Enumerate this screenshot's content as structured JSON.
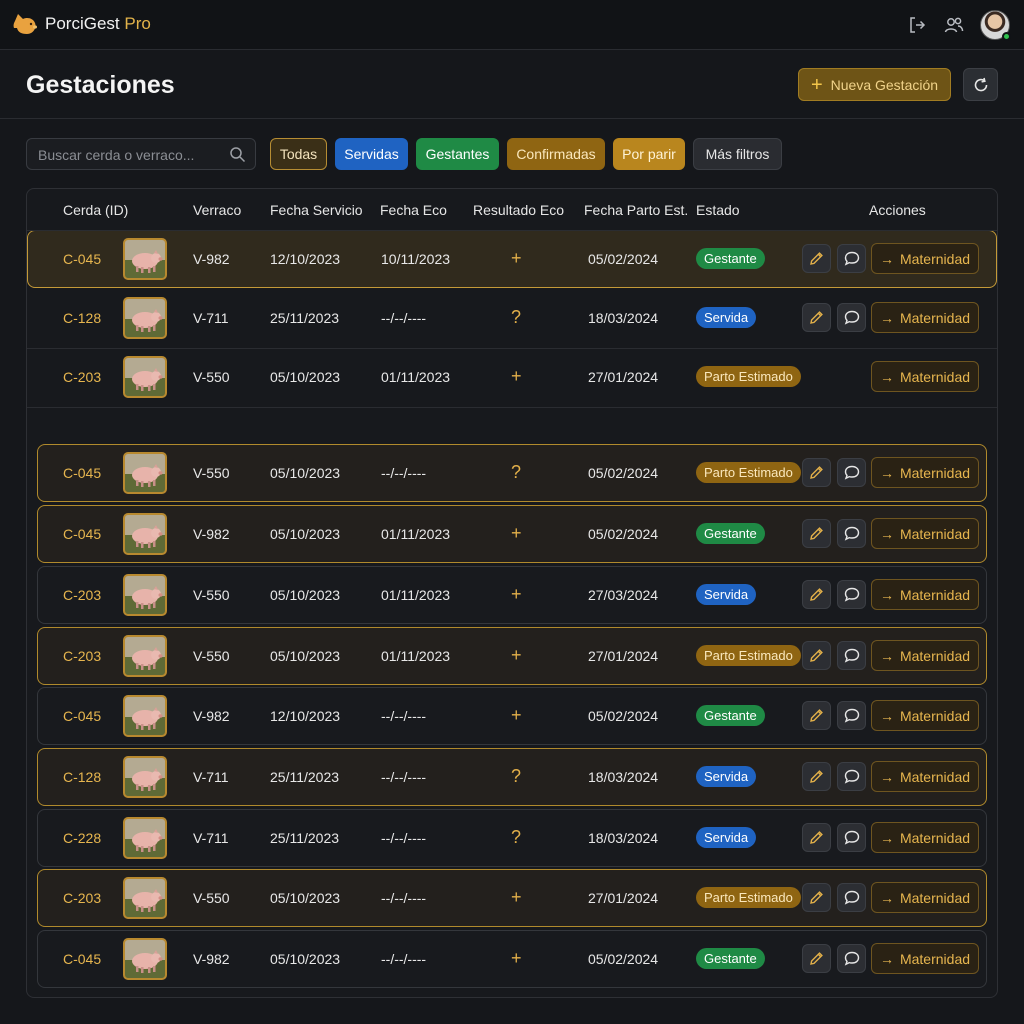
{
  "app": {
    "brand": "PorciGest",
    "brand_suffix": "Pro"
  },
  "header": {
    "title": "Gestaciones",
    "new_label": "Nueva Gestación"
  },
  "search": {
    "placeholder": "Buscar cerda o verraco..."
  },
  "filters": [
    {
      "label": "Todas",
      "active": true
    },
    {
      "label": "Servidas"
    },
    {
      "label": "Gestantes"
    },
    {
      "label": "Confirmadas"
    },
    {
      "label": "Por parir"
    },
    {
      "label": "Más filtros"
    }
  ],
  "columns": {
    "cerda": "Cerda (ID)",
    "verraco": "Verraco",
    "fecha_servicio": "Fecha Servicio",
    "fecha_eco": "Fecha Eco",
    "resultado_eco": "Resultado Eco",
    "fecha_parto": "Fecha Parto Est.",
    "estado": "Estado",
    "acciones": "Acciones"
  },
  "maternity_label": "Maternidad",
  "colors": {
    "accent": "#e7b64f",
    "gestante": "#1f8a45",
    "servida": "#1f63c2",
    "parto": "#8f6512"
  },
  "rows": [
    {
      "id": "C-045",
      "verraco": "V-982",
      "servicio": "12/10/2023",
      "eco": "10/11/2023",
      "resultado": "+",
      "parto": "05/02/2024",
      "estado": "Gestante",
      "tone": "green",
      "edit": true,
      "comment": true,
      "highlight": true
    },
    {
      "id": "C-128",
      "verraco": "V-711",
      "servicio": "25/11/2023",
      "eco": "--/--/----",
      "resultado": "?",
      "parto": "18/03/2024",
      "estado": "Servida",
      "tone": "blue",
      "edit": true,
      "comment": true,
      "highlight": false
    },
    {
      "id": "C-203",
      "verraco": "V-550",
      "servicio": "05/10/2023",
      "eco": "01/11/2023",
      "resultado": "+",
      "parto": "27/01/2024",
      "estado": "Parto Estimado",
      "tone": "amber",
      "edit": false,
      "comment": false,
      "highlight": false
    },
    {
      "id": "C-045",
      "verraco": "V-550",
      "servicio": "05/10/2023",
      "eco": "--/--/----",
      "resultado": "?",
      "parto": "05/02/2024",
      "estado": "Parto Estimado",
      "tone": "amber",
      "edit": true,
      "comment": true,
      "highlight": true
    },
    {
      "id": "C-045",
      "verraco": "V-982",
      "servicio": "05/10/2023",
      "eco": "01/11/2023",
      "resultado": "+",
      "parto": "05/02/2024",
      "estado": "Gestante",
      "tone": "green",
      "edit": true,
      "comment": true,
      "highlight": true
    },
    {
      "id": "C-203",
      "verraco": "V-550",
      "servicio": "05/10/2023",
      "eco": "01/11/2023",
      "resultado": "+",
      "parto": "27/03/2024",
      "estado": "Servida",
      "tone": "blue",
      "edit": true,
      "comment": true,
      "highlight": false
    },
    {
      "id": "C-203",
      "verraco": "V-550",
      "servicio": "05/10/2023",
      "eco": "01/11/2023",
      "resultado": "+",
      "parto": "27/01/2024",
      "estado": "Parto Estimado",
      "tone": "amber",
      "edit": true,
      "comment": true,
      "highlight": true
    },
    {
      "id": "C-045",
      "verraco": "V-982",
      "servicio": "12/10/2023",
      "eco": "--/--/----",
      "resultado": "+",
      "parto": "05/02/2024",
      "estado": "Gestante",
      "tone": "green",
      "edit": true,
      "comment": true,
      "highlight": false
    },
    {
      "id": "C-128",
      "verraco": "V-711",
      "servicio": "25/11/2023",
      "eco": "--/--/----",
      "resultado": "?",
      "parto": "18/03/2024",
      "estado": "Servida",
      "tone": "blue",
      "edit": true,
      "comment": true,
      "highlight": true
    },
    {
      "id": "C-228",
      "verraco": "V-711",
      "servicio": "25/11/2023",
      "eco": "--/--/----",
      "resultado": "?",
      "parto": "18/03/2024",
      "estado": "Servida",
      "tone": "blue",
      "edit": true,
      "comment": true,
      "highlight": false
    },
    {
      "id": "C-203",
      "verraco": "V-550",
      "servicio": "05/10/2023",
      "eco": "--/--/----",
      "resultado": "+",
      "parto": "27/01/2024",
      "estado": "Parto Estimado",
      "tone": "amber",
      "edit": true,
      "comment": true,
      "highlight": true
    },
    {
      "id": "C-045",
      "verraco": "V-982",
      "servicio": "05/10/2023",
      "eco": "--/--/----",
      "resultado": "+",
      "parto": "05/02/2024",
      "estado": "Gestante",
      "tone": "green",
      "edit": true,
      "comment": true,
      "highlight": false
    }
  ]
}
